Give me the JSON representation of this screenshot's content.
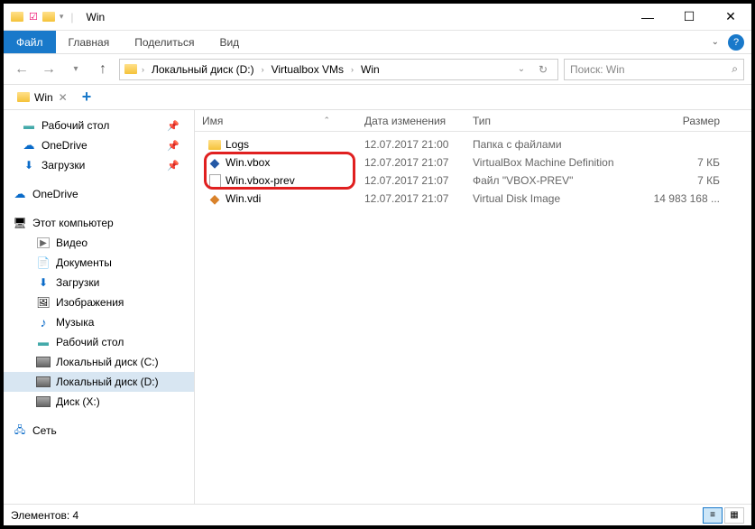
{
  "window": {
    "title": "Win"
  },
  "ribbon": {
    "file": "Файл",
    "home": "Главная",
    "share": "Поделиться",
    "view": "Вид"
  },
  "breadcrumb": {
    "disk": "Локальный диск (D:)",
    "folder1": "Virtualbox VMs",
    "folder2": "Win"
  },
  "search": {
    "placeholder": "Поиск: Win"
  },
  "tab": {
    "label": "Win"
  },
  "sidebar": {
    "desktop": "Рабочий стол",
    "onedrive": "OneDrive",
    "downloads": "Загрузки",
    "onedrive2": "OneDrive",
    "thispc": "Этот компьютер",
    "videos": "Видео",
    "documents": "Документы",
    "downloads2": "Загрузки",
    "pictures": "Изображения",
    "music": "Музыка",
    "desktop2": "Рабочий стол",
    "diskc": "Локальный диск (C:)",
    "diskd": "Локальный диск (D:)",
    "diskx": "Диск (X:)",
    "network": "Сеть"
  },
  "columns": {
    "name": "Имя",
    "date": "Дата изменения",
    "type": "Тип",
    "size": "Размер"
  },
  "files": [
    {
      "name": "Logs",
      "date": "12.07.2017 21:00",
      "type": "Папка с файлами",
      "size": ""
    },
    {
      "name": "Win.vbox",
      "date": "12.07.2017 21:07",
      "type": "VirtualBox Machine Definition",
      "size": "7 КБ"
    },
    {
      "name": "Win.vbox-prev",
      "date": "12.07.2017 21:07",
      "type": "Файл \"VBOX-PREV\"",
      "size": "7 КБ"
    },
    {
      "name": "Win.vdi",
      "date": "12.07.2017 21:07",
      "type": "Virtual Disk Image",
      "size": "14 983 168 ..."
    }
  ],
  "status": {
    "text": "Элементов: 4"
  }
}
